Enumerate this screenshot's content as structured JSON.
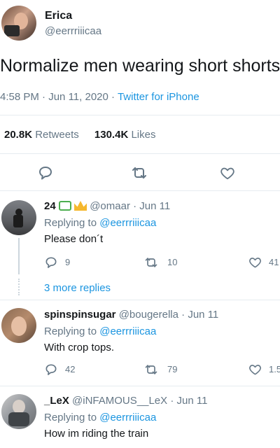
{
  "author": {
    "name": "Erica",
    "handle": "@eerrriiicaa"
  },
  "tweet": {
    "text": "Normalize men wearing short shorts",
    "time": "4:58 PM",
    "sep1": "·",
    "date": "Jun 11, 2020",
    "sep2": "·",
    "source": "Twitter for iPhone"
  },
  "stats": {
    "retweets_count": "20.8K",
    "retweets_label": "Retweets",
    "likes_count": "130.4K",
    "likes_label": "Likes"
  },
  "action_icons": [
    "reply-icon",
    "retweet-icon",
    "like-icon"
  ],
  "replies": [
    {
      "name": "24",
      "handle": "@omaar",
      "dot": "·",
      "date": "Jun 11",
      "replying_prefix": "Replying to",
      "replying_to": "@eerrriiicaa",
      "text": "Please don´t",
      "reply_count": "9",
      "retweet_count": "10",
      "like_count": "41"
    },
    {
      "name": "spinspinsugar",
      "handle": "@bougerella",
      "dot": "·",
      "date": "Jun 11",
      "replying_prefix": "Replying to",
      "replying_to": "@eerrriiicaa",
      "text": "With crop tops.",
      "reply_count": "42",
      "retweet_count": "79",
      "like_count": "1.5"
    },
    {
      "name": "_LeX",
      "handle": "@iNFAMOUS__LeX",
      "dot": "·",
      "date": "Jun 11",
      "replying_prefix": "Replying to",
      "replying_to": "@eerrriiicaa",
      "text": "How im riding the train"
    }
  ],
  "more_replies": "3 more replies",
  "colors": {
    "accent": "#1b95e0",
    "muted": "#657786",
    "text": "#14171a",
    "divider": "#e6ecf0"
  }
}
